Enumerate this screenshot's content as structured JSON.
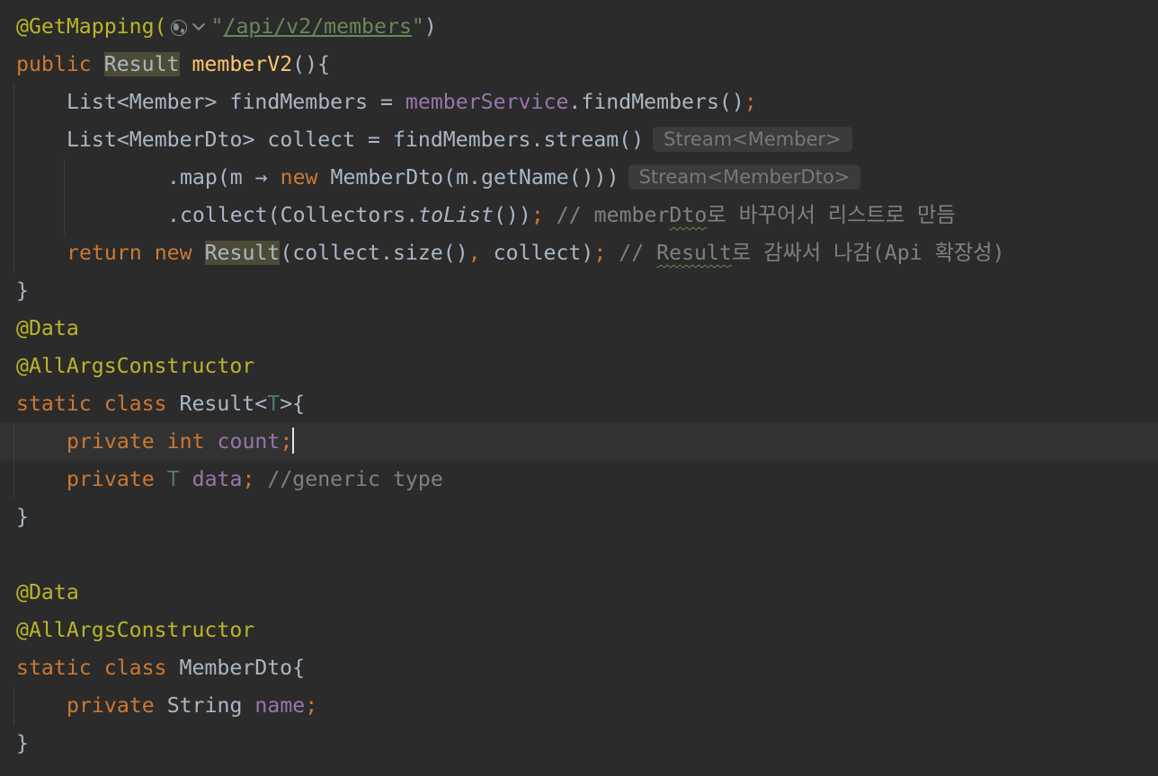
{
  "editor": {
    "lines": [
      {
        "indent": 0,
        "guides": 0,
        "segments": [
          {
            "text": "@GetMapping(",
            "type": "annotation"
          },
          {
            "icon": "globe-icon"
          },
          {
            "icon": "chevron-down-icon"
          },
          {
            "text": "\"",
            "type": "str"
          },
          {
            "text": "/api/v2/members",
            "type": "url"
          },
          {
            "text": "\"",
            "type": "str"
          },
          {
            "text": ")",
            "type": "plain"
          }
        ]
      },
      {
        "indent": 0,
        "guides": 0,
        "segments": [
          {
            "text": "public ",
            "type": "keyword"
          },
          {
            "text": "Result",
            "type": "plain",
            "highlight": true
          },
          {
            "text": " ",
            "type": "plain"
          },
          {
            "text": "memberV2",
            "type": "method"
          },
          {
            "text": "(){",
            "type": "plain"
          }
        ]
      },
      {
        "indent": 1,
        "guides": 1,
        "segments": [
          {
            "text": "List<Member> findMembers = ",
            "type": "plain"
          },
          {
            "text": "memberService",
            "type": "field"
          },
          {
            "text": ".findMembers()",
            "type": "plain"
          },
          {
            "text": ";",
            "type": "keyword"
          }
        ]
      },
      {
        "indent": 1,
        "guides": 1,
        "segments": [
          {
            "text": "List<MemberDto> collect = findMembers.stream()",
            "type": "plain"
          },
          {
            "hint": "Stream<Member>"
          }
        ]
      },
      {
        "indent": 3,
        "guides": 2,
        "segments": [
          {
            "text": ".map(m → ",
            "type": "plain"
          },
          {
            "text": "new ",
            "type": "keyword"
          },
          {
            "text": "MemberDto(m.getName()))",
            "type": "plain"
          },
          {
            "hint": "Stream<MemberDto>"
          }
        ]
      },
      {
        "indent": 3,
        "guides": 2,
        "segments": [
          {
            "text": ".collect(Collectors.",
            "type": "plain"
          },
          {
            "text": "toList",
            "type": "plain",
            "italic": true
          },
          {
            "text": "())",
            "type": "plain"
          },
          {
            "text": "; ",
            "type": "keyword"
          },
          {
            "text": "// member",
            "type": "comment"
          },
          {
            "text": "Dto",
            "type": "comment",
            "typo": true
          },
          {
            "text": "로 바꾸어서 리스트로 만듬",
            "type": "comment"
          }
        ]
      },
      {
        "indent": 1,
        "guides": 1,
        "segments": [
          {
            "text": "return new ",
            "type": "keyword"
          },
          {
            "text": "Result",
            "type": "plain",
            "highlight": true
          },
          {
            "text": "(collect.size()",
            "type": "plain"
          },
          {
            "text": ", ",
            "type": "keyword"
          },
          {
            "text": "collect)",
            "type": "plain"
          },
          {
            "text": "; ",
            "type": "keyword"
          },
          {
            "text": "// ",
            "type": "comment"
          },
          {
            "text": "Result",
            "type": "comment",
            "typo": true
          },
          {
            "text": "로 감싸서 나감(Api 확장성)",
            "type": "comment"
          }
        ]
      },
      {
        "indent": 0,
        "guides": 0,
        "segments": [
          {
            "text": "}",
            "type": "plain"
          }
        ]
      },
      {
        "indent": 0,
        "guides": 0,
        "segments": [
          {
            "text": "@Data",
            "type": "annotation"
          }
        ]
      },
      {
        "indent": 0,
        "guides": 0,
        "segments": [
          {
            "text": "@AllArgsConstructor",
            "type": "annotation"
          }
        ]
      },
      {
        "indent": 0,
        "guides": 0,
        "segments": [
          {
            "text": "static class ",
            "type": "keyword"
          },
          {
            "text": "Result<",
            "type": "plain"
          },
          {
            "text": "T",
            "type": "typeparam"
          },
          {
            "text": ">{",
            "type": "plain"
          }
        ]
      },
      {
        "indent": 1,
        "guides": 1,
        "current": true,
        "segments": [
          {
            "text": "private int ",
            "type": "keyword"
          },
          {
            "text": "count",
            "type": "field"
          },
          {
            "text": ";",
            "type": "keyword"
          },
          {
            "caret": true
          }
        ]
      },
      {
        "indent": 1,
        "guides": 1,
        "segments": [
          {
            "text": "private ",
            "type": "keyword"
          },
          {
            "text": "T ",
            "type": "typeparam"
          },
          {
            "text": "data",
            "type": "field"
          },
          {
            "text": "; ",
            "type": "keyword"
          },
          {
            "text": "//generic type",
            "type": "comment"
          }
        ]
      },
      {
        "indent": 0,
        "guides": 0,
        "segments": [
          {
            "text": "}",
            "type": "plain"
          }
        ]
      },
      {
        "indent": 0,
        "guides": 0,
        "segments": []
      },
      {
        "indent": 0,
        "guides": 0,
        "segments": [
          {
            "text": "@Data",
            "type": "annotation"
          }
        ]
      },
      {
        "indent": 0,
        "guides": 0,
        "segments": [
          {
            "text": "@AllArgsConstructor",
            "type": "annotation"
          }
        ]
      },
      {
        "indent": 0,
        "guides": 0,
        "segments": [
          {
            "text": "static class ",
            "type": "keyword"
          },
          {
            "text": "MemberDto{",
            "type": "plain"
          }
        ]
      },
      {
        "indent": 1,
        "guides": 1,
        "segments": [
          {
            "text": "private ",
            "type": "keyword"
          },
          {
            "text": "String ",
            "type": "plain"
          },
          {
            "text": "name",
            "type": "field"
          },
          {
            "text": ";",
            "type": "keyword"
          }
        ]
      },
      {
        "indent": 0,
        "guides": 0,
        "segments": [
          {
            "text": "}",
            "type": "plain"
          }
        ]
      }
    ]
  },
  "colors": {
    "background": "#2b2b2b",
    "current_line": "#323232",
    "keyword": "#cc7832",
    "annotation": "#bbb529",
    "string": "#6a8759",
    "field": "#9876aa",
    "method": "#ffc66d",
    "comment": "#808080",
    "plain": "#a9b7c6",
    "type_param": "#507874",
    "usage_highlight": "#4d4b36",
    "inlay_hint_bg": "#3b3b3b",
    "inlay_hint_text": "#787878"
  }
}
